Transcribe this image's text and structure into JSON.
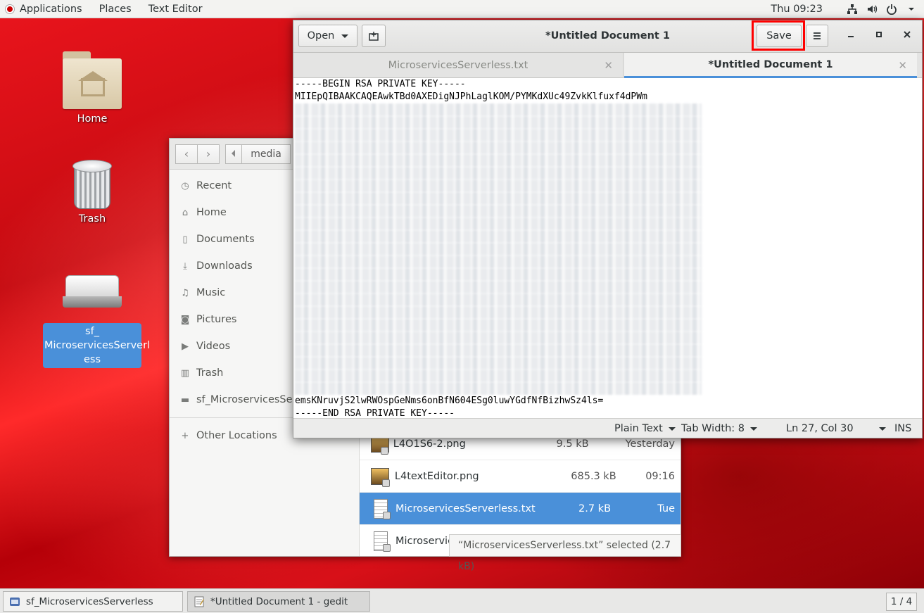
{
  "topbar": {
    "applications": "Applications",
    "places": "Places",
    "app_menu": "Text Editor",
    "clock": "Thu 09:23",
    "icons": [
      "network-icon",
      "volume-icon",
      "power-icon",
      "chevron-down-icon"
    ]
  },
  "desktop": {
    "home_label": "Home",
    "trash_label": "Trash",
    "drive_label": "sf_ MicroservicesServerl ess"
  },
  "files": {
    "path_button": "media",
    "sidebar": [
      {
        "label": "Recent",
        "icon": "clock-icon"
      },
      {
        "label": "Home",
        "icon": "home-icon"
      },
      {
        "label": "Documents",
        "icon": "document-icon"
      },
      {
        "label": "Downloads",
        "icon": "download-icon"
      },
      {
        "label": "Music",
        "icon": "music-icon"
      },
      {
        "label": "Pictures",
        "icon": "camera-icon"
      },
      {
        "label": "Videos",
        "icon": "video-icon"
      },
      {
        "label": "Trash",
        "icon": "trash-icon"
      },
      {
        "label": "sf_MicroservicesServe",
        "icon": "drive-icon"
      }
    ],
    "other_locations": "Other Locations",
    "rows": [
      {
        "name": "L4O1S6-2.png",
        "size": "9.5 kB",
        "date": "Yesterday",
        "type": "image"
      },
      {
        "name": "L4textEditor.png",
        "size": "685.3 kB",
        "date": "09:16",
        "type": "image"
      },
      {
        "name": "MicroservicesServerless.txt",
        "size": "2.7 kB",
        "date": "Tue",
        "type": "text",
        "selected": true
      },
      {
        "name": "Microservice",
        "size": "",
        "date": "",
        "type": "image"
      }
    ],
    "status": "“MicroservicesServerless.txt” selected  (2.7 kB)"
  },
  "gedit": {
    "title": "*Untitled Document 1",
    "open_label": "Open",
    "save_label": "Save",
    "tabs": [
      {
        "label": "MicroservicesServerless.txt",
        "active": false
      },
      {
        "label": "*Untitled Document 1",
        "active": true
      }
    ],
    "lines": {
      "begin": "-----BEGIN RSA PRIVATE KEY-----",
      "first": "MIIEpQIBAAKCAQEAwkTBd0AXEDigNJPhLaglKOM/PYMKdXUc49ZvkKlfuxf4dPWm",
      "last": "emsKNruvjS2lwRWOspGeNms6onBfN604ESg0luwYGdfNfBizhwSz4ls=",
      "end": "-----END RSA PRIVATE KEY-----"
    },
    "blurred_line_count": 23,
    "statusbar": {
      "language": "Plain Text",
      "tab_width": "Tab Width: 8",
      "position": "Ln 27, Col 30",
      "mode": "INS"
    }
  },
  "taskbar": {
    "task1": "sf_MicroservicesServerless",
    "task2": "*Untitled Document 1 - gedit",
    "pager": "1 / 4"
  },
  "colors": {
    "accent": "#4a90d9",
    "highlight_box": "#ff0000",
    "desktop_red": "#d81018"
  }
}
